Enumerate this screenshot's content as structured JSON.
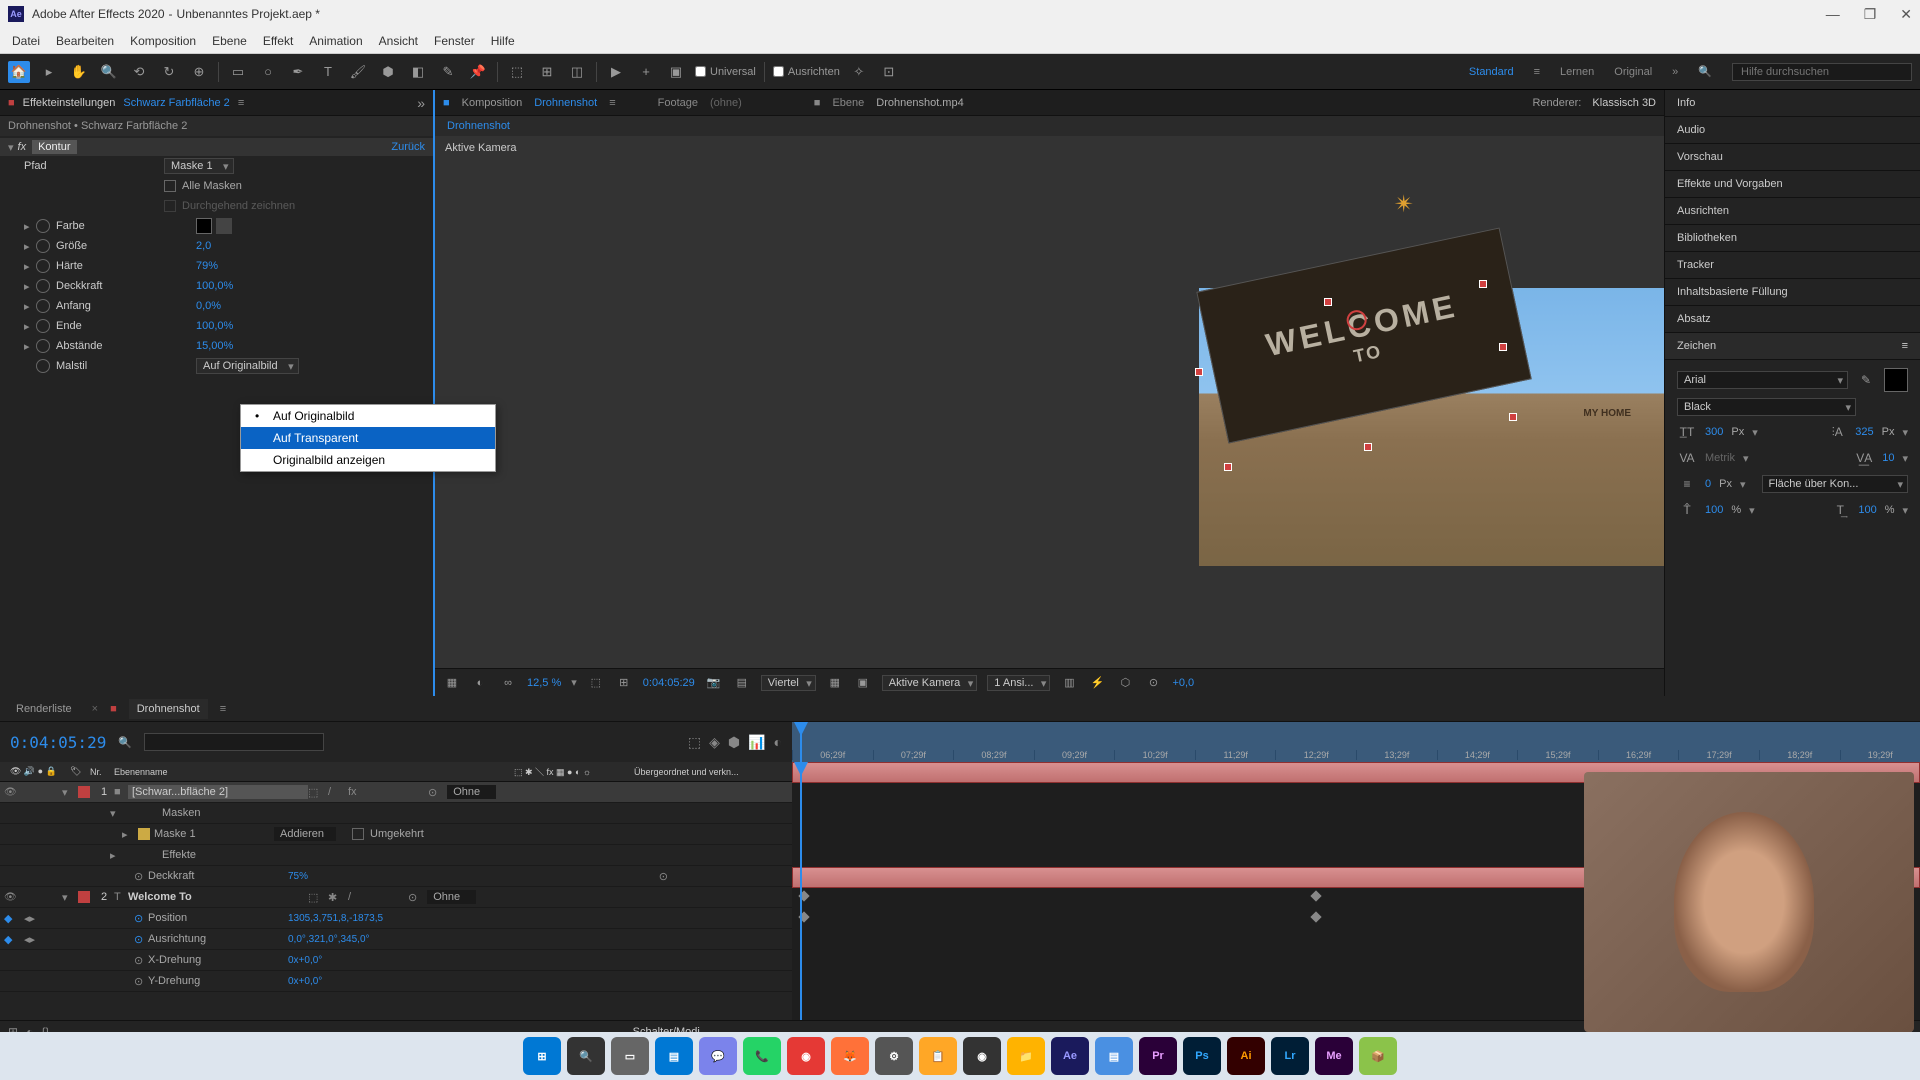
{
  "titlebar": {
    "app": "Adobe After Effects 2020",
    "project": "Unbenanntes Projekt.aep *"
  },
  "menubar": [
    "Datei",
    "Bearbeiten",
    "Komposition",
    "Ebene",
    "Effekt",
    "Animation",
    "Ansicht",
    "Fenster",
    "Hilfe"
  ],
  "toolbar": {
    "snapping": "Universal",
    "align": "Ausrichten",
    "workspaces": [
      "Standard",
      "Lernen",
      "Original"
    ],
    "search_placeholder": "Hilfe durchsuchen"
  },
  "effects_panel": {
    "tab": "Effekteinstellungen",
    "tab_link": "Schwarz Farbfläche 2",
    "breadcrumb": "Drohnenshot • Schwarz Farbfläche 2",
    "effect_name": "Kontur",
    "reset": "Zurück",
    "props": {
      "pfad": {
        "label": "Pfad",
        "value": "Maske 1"
      },
      "alle_masken": {
        "label": "Alle Masken"
      },
      "durchgehend": {
        "label": "Durchgehend zeichnen"
      },
      "farbe": {
        "label": "Farbe"
      },
      "groesse": {
        "label": "Größe",
        "value": "2,0"
      },
      "haerte": {
        "label": "Härte",
        "value": "79"
      },
      "deckkraft": {
        "label": "Deckkraft",
        "value": "100,0"
      },
      "anfang": {
        "label": "Anfang",
        "value": "0,0"
      },
      "ende": {
        "label": "Ende",
        "value": "100,0"
      },
      "abstaende": {
        "label": "Abstände",
        "value": "15,00"
      },
      "malstil": {
        "label": "Malstil",
        "value": "Auf Originalbild"
      }
    },
    "popup": {
      "items": [
        "Auf Originalbild",
        "Auf Transparent",
        "Originalbild anzeigen"
      ],
      "selected": 0,
      "highlighted": 1
    }
  },
  "comp_panel": {
    "tab_prefix": "Komposition",
    "tab_link": "Drohnenshot",
    "footage": "Footage",
    "footage_none": "(ohne)",
    "ebene": "Ebene",
    "ebene_name": "Drohnenshot.mp4",
    "renderer_label": "Renderer:",
    "renderer": "Klassisch 3D",
    "breadcrumb": "Drohnenshot",
    "camera": "Aktive Kamera",
    "billboard_t1": "WELCOME",
    "billboard_t2": "TO",
    "billboard_side": "MY HOME"
  },
  "viewer_toolbar": {
    "zoom": "12,5 %",
    "timecode": "0:04:05:29",
    "quality": "Viertel",
    "camera": "Aktive Kamera",
    "views": "1 Ansi...",
    "exposure": "+0,0"
  },
  "right_panel": {
    "sections": [
      "Info",
      "Audio",
      "Vorschau",
      "Effekte und Vorgaben",
      "Ausrichten",
      "Bibliotheken",
      "Tracker",
      "Inhaltsbasierte Füllung",
      "Absatz"
    ],
    "char_title": "Zeichen",
    "font": "Arial",
    "weight": "Black",
    "size": "300",
    "size_unit": "Px",
    "leading": "325",
    "leading_unit": "Px",
    "kerning": "Metrik",
    "tracking": "10",
    "stroke": "0",
    "stroke_unit": "Px",
    "stroke_mode": "Fläche über Kon...",
    "vscale": "100",
    "hscale": "100"
  },
  "timeline": {
    "tabs": [
      "Renderliste",
      "Drohnenshot"
    ],
    "timecode": "0:04:05:29",
    "ticks": [
      "06;29f",
      "07;29f",
      "08;29f",
      "09;29f",
      "10;29f",
      "11;29f",
      "12;29f",
      "13;29f",
      "14;29f",
      "15;29f",
      "16;29f",
      "17;29f",
      "18;29f",
      "19;29f"
    ],
    "col_layer": "Ebenenname",
    "col_parent": "Übergeordnet und verkn...",
    "layers": [
      {
        "num": "1",
        "name": "[Schwar...bfläche 2]",
        "parent": "Ohne",
        "selected": true
      },
      {
        "num": "2",
        "name": "Welcome To",
        "parent": "Ohne"
      }
    ],
    "sub": {
      "masken": "Masken",
      "maske1": "Maske 1",
      "maske1_mode": "Addieren",
      "maske1_inv": "Umgekehrt",
      "effekte": "Effekte",
      "deckkraft": "Deckkraft",
      "deckkraft_val": "75",
      "position": "Position",
      "position_val": "1305,3,751,8,-1873,5",
      "ausrichtung": "Ausrichtung",
      "ausrichtung_val": "0,0°,321,0°,345,0°",
      "xdrehung": "X-Drehung",
      "xdrehung_val": "0x+0,0°",
      "ydrehung": "Y-Drehung",
      "ydrehung_val": "0x+0,0°"
    },
    "footer": "Schalter/Modi"
  },
  "taskbar_apps": [
    "⊞",
    "🔍",
    "▭",
    "▤",
    "💬",
    "📞",
    "📧",
    "🦊",
    "⚙",
    "📁",
    "🎬",
    "📁",
    "Ae",
    "▤",
    "Pr",
    "Ps",
    "Ai",
    "Lr",
    "Me",
    "📦"
  ]
}
